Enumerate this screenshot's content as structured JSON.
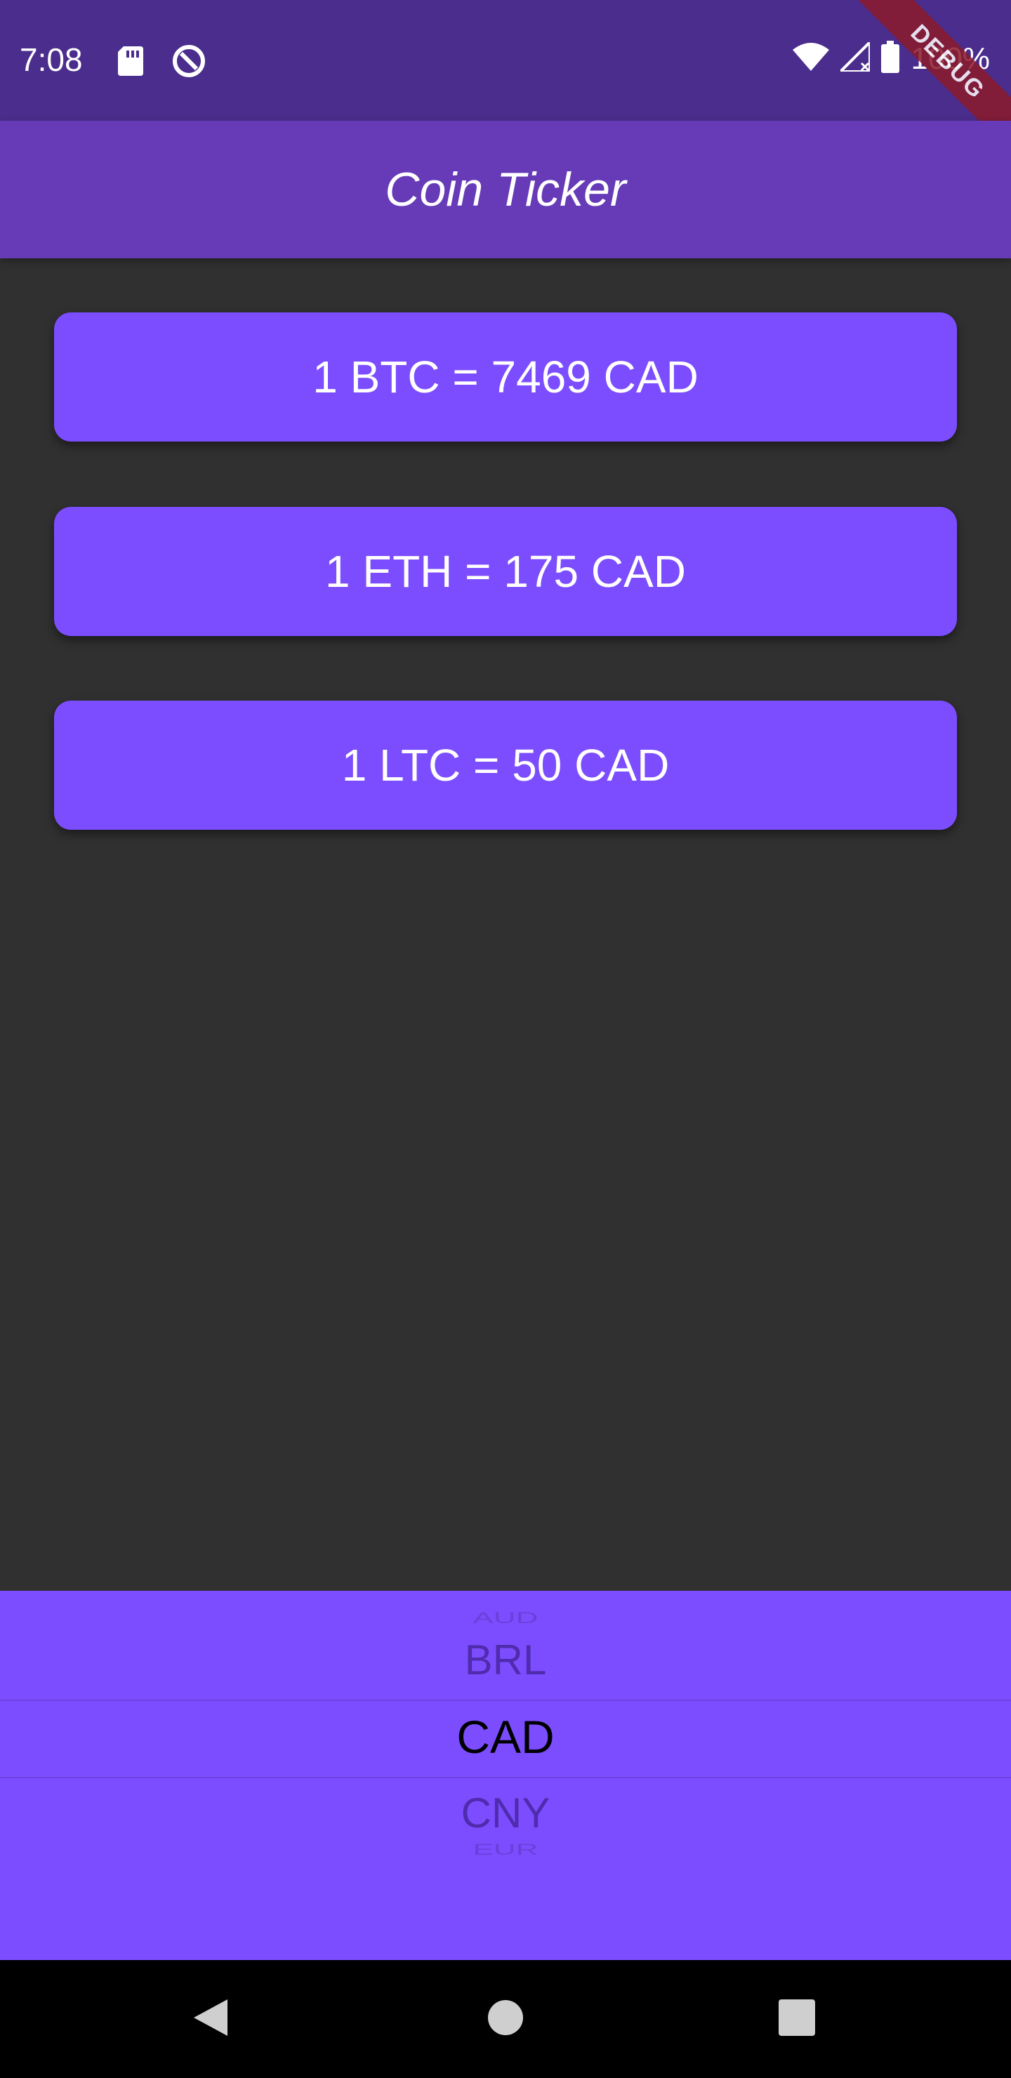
{
  "status_bar": {
    "time": "7:08",
    "battery_percent": "100%",
    "icons": [
      "sd-card-icon",
      "data-saver-icon",
      "wifi-icon",
      "signal-icon",
      "battery-icon"
    ]
  },
  "debug_banner": "DEBUG",
  "app_bar": {
    "title": "Coin Ticker"
  },
  "tickers": [
    {
      "text": "1 BTC = 7469 CAD"
    },
    {
      "text": "1 ETH = 175 CAD"
    },
    {
      "text": "1 LTC = 50 CAD"
    }
  ],
  "currency_picker": {
    "selected": "CAD",
    "visible_options": [
      "AUD",
      "BRL",
      "CAD",
      "CNY",
      "EUR"
    ]
  },
  "nav_bar": {
    "icons": [
      "back-icon",
      "home-icon",
      "recents-icon"
    ]
  },
  "colors": {
    "status_bar": "#4a2d8c",
    "app_bar": "#673ab7",
    "accent": "#7c4dff",
    "background": "#303030"
  }
}
